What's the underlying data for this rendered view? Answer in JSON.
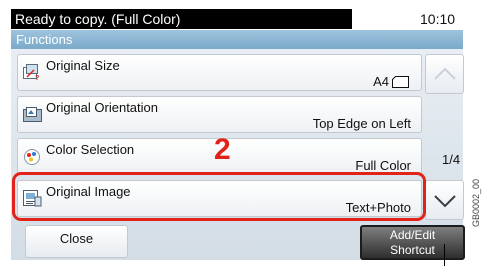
{
  "status": {
    "message": "Ready to copy. (Full Color)",
    "clock": "10:10"
  },
  "header": {
    "title": "Functions"
  },
  "functions": [
    {
      "label": "Original Size",
      "value": "A4",
      "icon": "original-size-icon"
    },
    {
      "label": "Original Orientation",
      "value": "Top Edge on Left",
      "icon": "orientation-icon"
    },
    {
      "label": "Color Selection",
      "value": "Full Color",
      "icon": "color-selection-icon"
    },
    {
      "label": "Original Image",
      "value": "Text+Photo",
      "icon": "original-image-icon"
    }
  ],
  "pager": {
    "indicator": "1/4"
  },
  "footer": {
    "close_label": "Close",
    "shortcut_line1": "Add/Edit",
    "shortcut_line2": "Shortcut"
  },
  "annotation": {
    "step_number": "2",
    "figure_code": "GB0002_00"
  },
  "colors": {
    "highlight": "#e2231a",
    "header": "#8cb7d4",
    "status_bar": "#000000"
  }
}
